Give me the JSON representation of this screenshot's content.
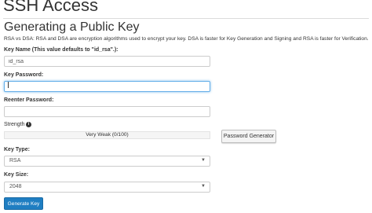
{
  "page": {
    "title": "SSH Access",
    "section_title": "Generating a Public Key",
    "description": "RSA vs DSA: RSA and DSA are encryption algorithms used to encrypt your key. DSA is faster for Key Generation and Signing and RSA is faster for Verification."
  },
  "form": {
    "key_name": {
      "label": "Key Name (This value defaults to \"id_rsa\".):",
      "value": "id_rsa"
    },
    "key_password": {
      "label": "Key Password:",
      "value": ""
    },
    "reenter_password": {
      "label": "Reenter Password:",
      "value": ""
    },
    "strength": {
      "label": "Strength",
      "icon": "info-icon",
      "meter_text": "Very Weak (0/100)",
      "score": 0
    },
    "password_generator_label": "Password Generator",
    "key_type": {
      "label": "Key Type:",
      "selected": "RSA"
    },
    "key_size": {
      "label": "Key Size:",
      "selected": "2048"
    },
    "generate_label": "Generate Key"
  },
  "colors": {
    "primary": "#1f7ec2",
    "focus": "#66afe9"
  }
}
